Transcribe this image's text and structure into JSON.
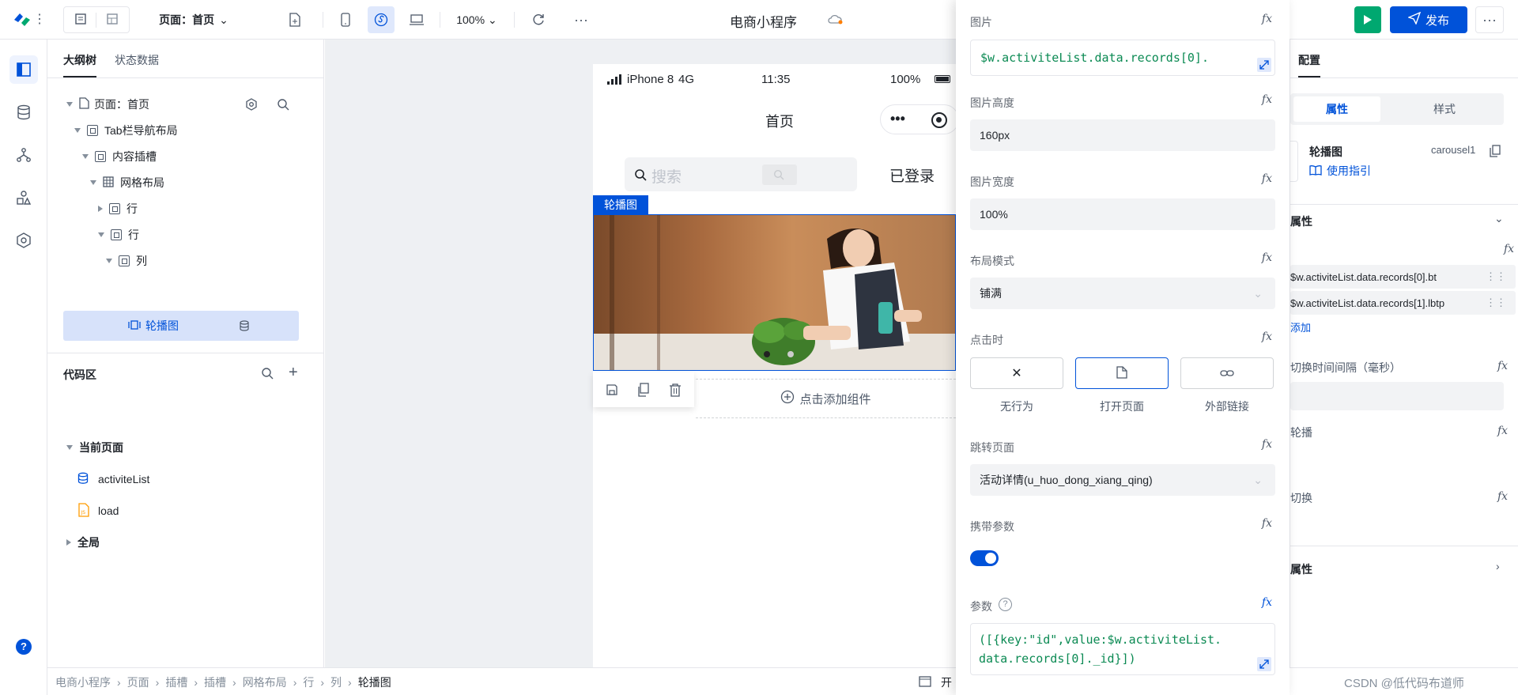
{
  "app": {
    "title": "电商小程序"
  },
  "toolbar": {
    "page_selector": "页面：首页",
    "zoom": "100%",
    "publish": "发布"
  },
  "tree_panel": {
    "tabs": [
      "大纲树",
      "状态数据"
    ],
    "nodes": [
      "页面：首页",
      "Tab栏导航布局",
      "内容插槽",
      "网格布局",
      "行",
      "行",
      "列",
      "轮播图"
    ]
  },
  "code_panel": {
    "title": "代码区",
    "current_page": "当前页面",
    "items": [
      "activiteList",
      "load"
    ],
    "global": "全局"
  },
  "phone": {
    "status_device": "iPhone 8",
    "status_net": "4G",
    "time": "11:35",
    "battery": "100%",
    "nav_title": "首页",
    "search_placeholder": "搜索",
    "login_text": "已登录",
    "component_tag": "轮播图",
    "add_component": "点击添加组件"
  },
  "props": {
    "image_label": "图片",
    "image_value": "$w.activiteList.data.records[0].",
    "height_label": "图片高度",
    "height_value": "160px",
    "width_label": "图片宽度",
    "width_value": "100%",
    "layout_label": "布局模式",
    "layout_value": "铺满",
    "click_label": "点击时",
    "click_options": [
      "无行为",
      "打开页面",
      "外部链接"
    ],
    "jump_label": "跳转页面",
    "jump_value": "活动详情(u_huo_dong_xiang_qing)",
    "carry_label": "携带参数",
    "carry_on": true,
    "param_label": "参数",
    "param_value_line1": "([{key:\"id\",value:$w.activiteList.",
    "param_value_line2": "data.records[0]._id}])"
  },
  "right_panel": {
    "tab": "配置",
    "subtabs": [
      "属性",
      "样式"
    ],
    "component_name": "轮播图",
    "component_id": "carousel1",
    "guide": "使用指引",
    "section_title": "属性",
    "row1_value": "$w.activiteList.data.records[0].bt",
    "row2_value": "$w.activiteList.data.records[1].lbtp",
    "add_text": "添加",
    "interval_label": "切换时间间隔（毫秒）",
    "autoplay_label": "轮播",
    "switch_label": "切换",
    "advanced_label": "属性"
  },
  "breadcrumb": {
    "items": [
      "电商小程序",
      "页面",
      "插槽",
      "插槽",
      "网格布局",
      "行",
      "列",
      "轮播图"
    ],
    "right_text": "开",
    "watermark": "CSDN @低代码布道师"
  },
  "colors": {
    "primary": "#0052d9",
    "green": "#00a870",
    "code_green": "#0b8a53"
  }
}
